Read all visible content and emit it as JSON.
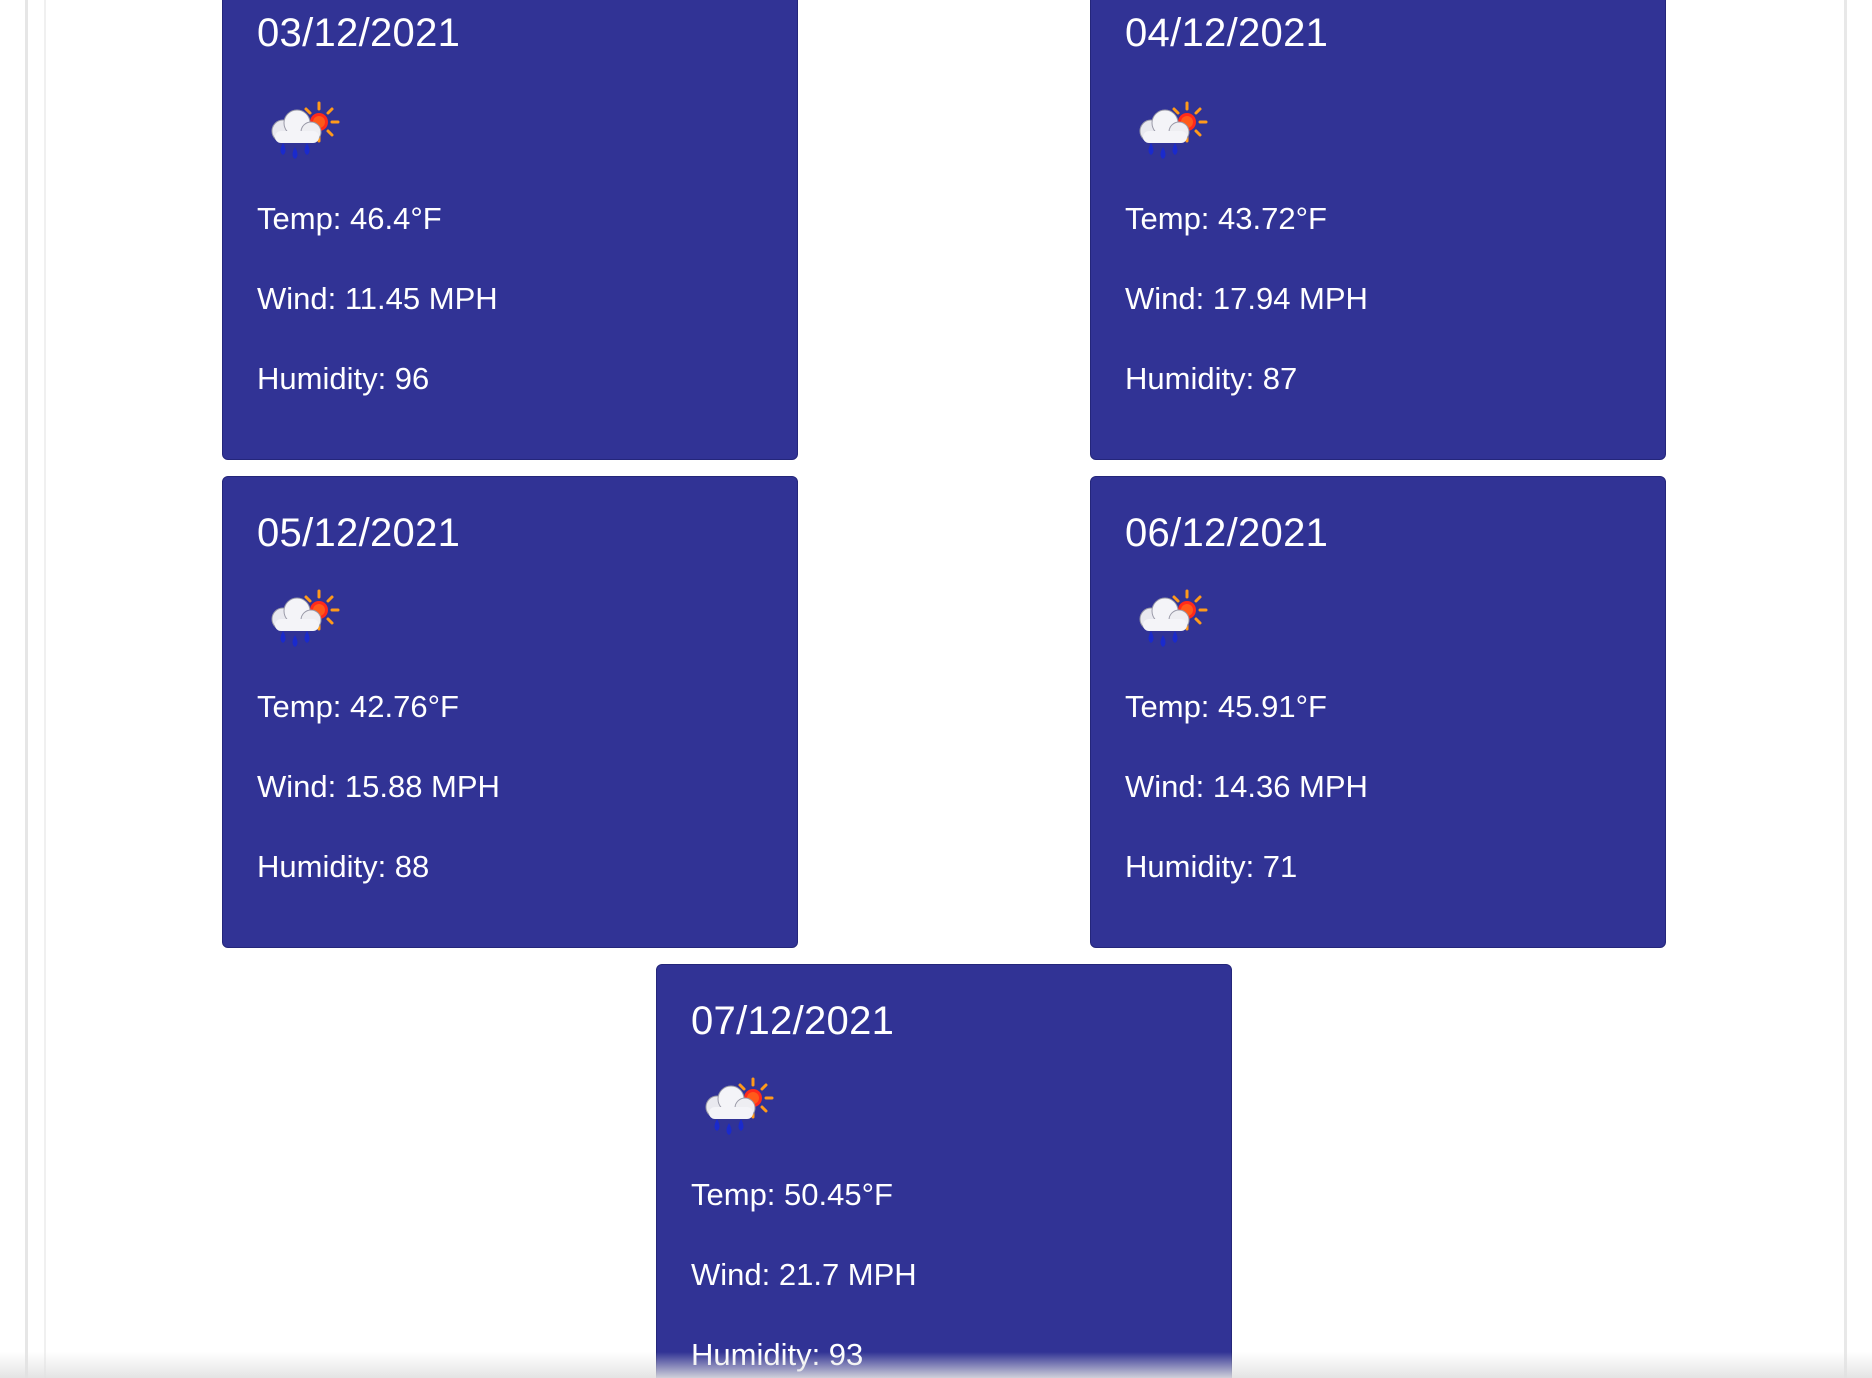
{
  "forecast": {
    "cards": [
      {
        "date": "03/12/2021",
        "icon": "rain-cloud-sun-icon",
        "temp": "Temp: 46.4°F",
        "wind": "Wind: 11.45 MPH",
        "humidity": "Humidity: 96"
      },
      {
        "date": "04/12/2021",
        "icon": "rain-cloud-sun-icon",
        "temp": "Temp: 43.72°F",
        "wind": "Wind: 17.94 MPH",
        "humidity": "Humidity: 87"
      },
      {
        "date": "05/12/2021",
        "icon": "rain-cloud-sun-icon",
        "temp": "Temp: 42.76°F",
        "wind": "Wind: 15.88 MPH",
        "humidity": "Humidity: 88"
      },
      {
        "date": "06/12/2021",
        "icon": "rain-cloud-sun-icon",
        "temp": "Temp: 45.91°F",
        "wind": "Wind: 14.36 MPH",
        "humidity": "Humidity: 71"
      },
      {
        "date": "07/12/2021",
        "icon": "rain-cloud-sun-icon",
        "temp": "Temp: 50.45°F",
        "wind": "Wind: 21.7 MPH",
        "humidity": "Humidity: 93"
      }
    ]
  },
  "colors": {
    "card_background": "#313395",
    "card_text": "#ffffff",
    "page_background": "#ffffff"
  }
}
